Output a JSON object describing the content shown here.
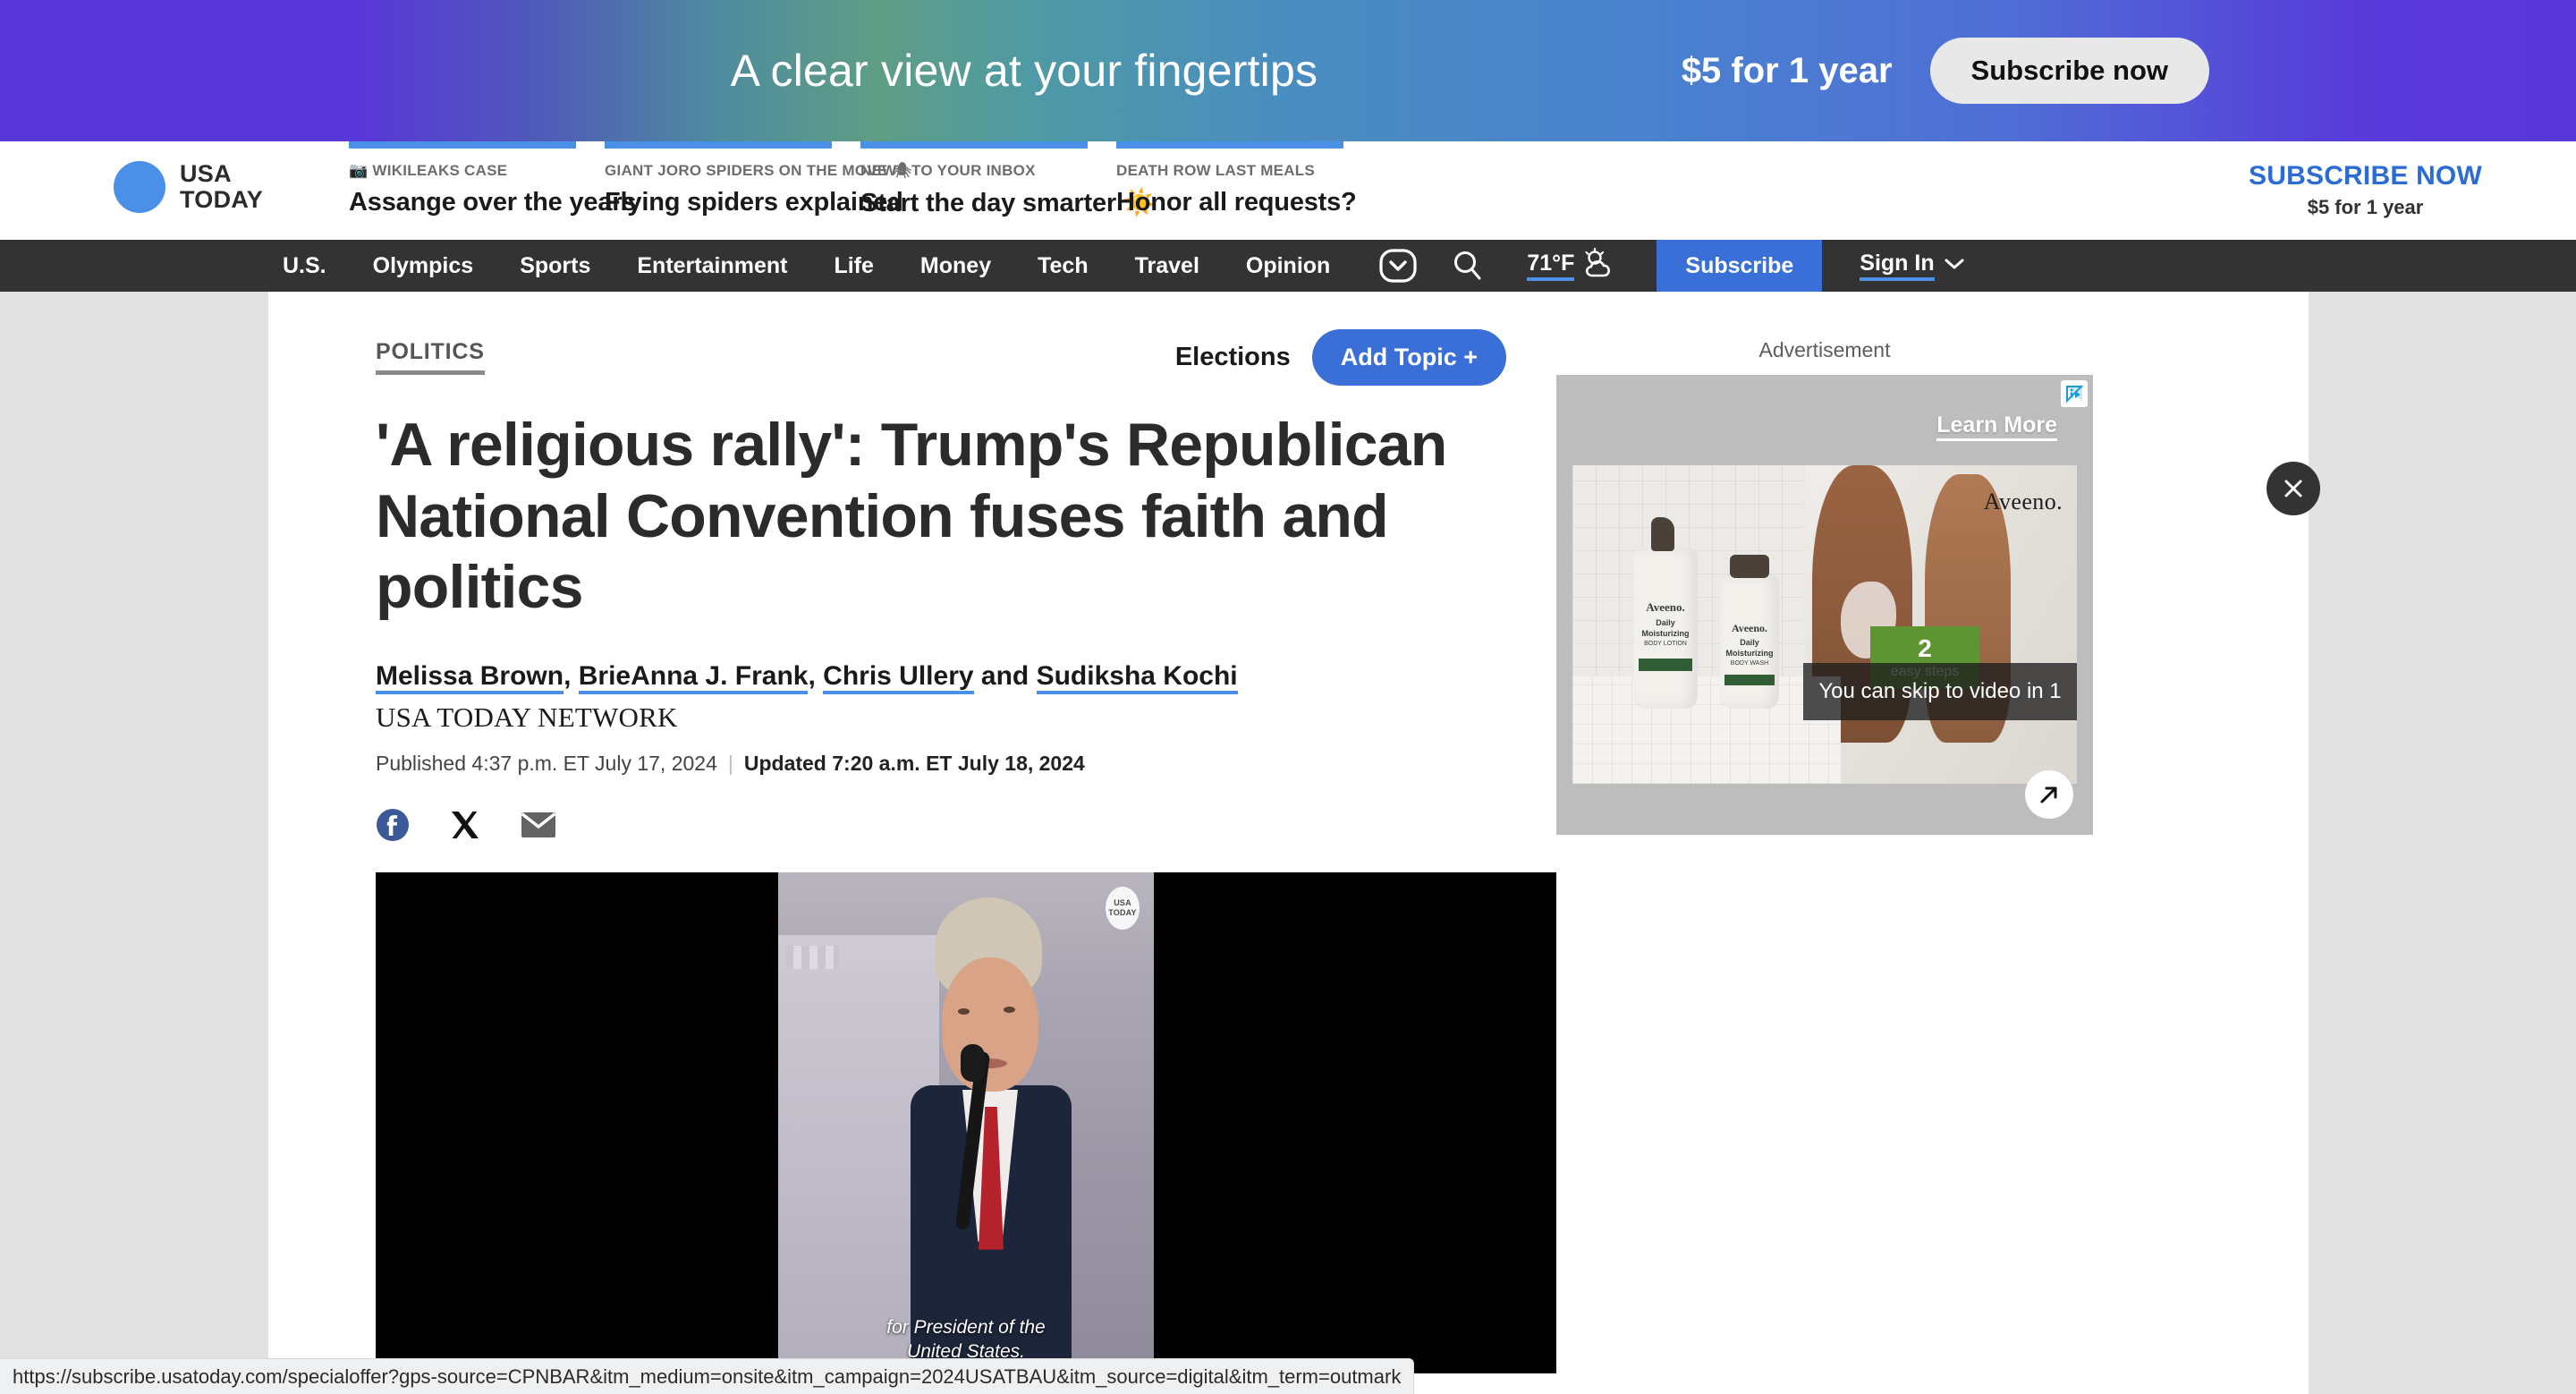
{
  "promo_banner": {
    "headline": "A clear view at your fingertips",
    "price": "$5 for 1 year",
    "cta_label": "Subscribe now",
    "gradient_start": "#5837d8",
    "gradient_mid": "#4a8dc0"
  },
  "brand": {
    "line1": "USA",
    "line2": "TODAY",
    "dot_color": "#4a90e8"
  },
  "topic_cards": [
    {
      "kicker": "📷 WIKILEAKS CASE",
      "title": "Assange over the years"
    },
    {
      "kicker": "GIANT JORO SPIDERS ON THE MOVE 🕷",
      "title": "Flying spiders explained"
    },
    {
      "kicker": "NEWS TO YOUR INBOX",
      "title": "Start the day smarter ☀️"
    },
    {
      "kicker": "DEATH ROW LAST MEALS",
      "title": "Honor all requests?"
    }
  ],
  "header_subscribe": {
    "line1": "SUBSCRIBE NOW",
    "line2": "$5 for 1 year",
    "color": "#2b6cd4"
  },
  "nav": {
    "links": [
      "U.S.",
      "Olympics",
      "Sports",
      "Entertainment",
      "Life",
      "Money",
      "Tech",
      "Travel",
      "Opinion"
    ],
    "more_icon": "chevron-down-icon",
    "search_icon": "search-icon",
    "weather": {
      "temp": "71°F",
      "icon": "partly-cloudy-icon"
    },
    "subscribe_label": "Subscribe",
    "signin_label": "Sign In",
    "subscribe_bg": "#3a6fd8",
    "bar_bg": "#333333"
  },
  "article": {
    "section": "POLITICS",
    "elections_label": "Elections",
    "add_topic_label": "Add Topic +",
    "headline": "'A religious rally': Trump's Republican National Convention fuses faith and politics",
    "authors": [
      "Melissa Brown",
      "BrieAnna J. Frank",
      "Chris Ullery",
      "Sudiksha Kochi"
    ],
    "author_sep": ", ",
    "author_last_sep": " and ",
    "network": "USA TODAY NETWORK",
    "published": "Published 4:37 p.m. ET July 17, 2024",
    "updated": "Updated 7:20 a.m. ET July 18, 2024",
    "share_icons": [
      "facebook-icon",
      "x-twitter-icon",
      "email-icon"
    ],
    "video": {
      "caption_line1": "for President of the",
      "caption_line2": "United States.",
      "watermark_line1": "USA",
      "watermark_line2": "TODAY"
    }
  },
  "ad": {
    "label": "Advertisement",
    "learn_more": "Learn More",
    "brand": "Aveeno.",
    "steps_number": "2",
    "steps_text": "easy steps",
    "skip_text": "You can skip to video in 1",
    "adchoices_icon": "adchoices-icon",
    "expand_icon": "expand-arrow-icon",
    "close_icon": "close-icon",
    "bottle1": {
      "name": "Aveeno.",
      "l1": "Daily",
      "l2": "Moisturizing",
      "l3": "BODY LOTION"
    },
    "bottle2": {
      "name": "Aveeno.",
      "l1": "Daily",
      "l2": "Moisturizing",
      "l3": "BODY WASH"
    }
  },
  "status_bar": {
    "url": "https://subscribe.usatoday.com/specialoffer?gps-source=CPNBAR&itm_medium=onsite&itm_campaign=2024USATBAU&itm_source=digital&itm_term=outmark"
  }
}
